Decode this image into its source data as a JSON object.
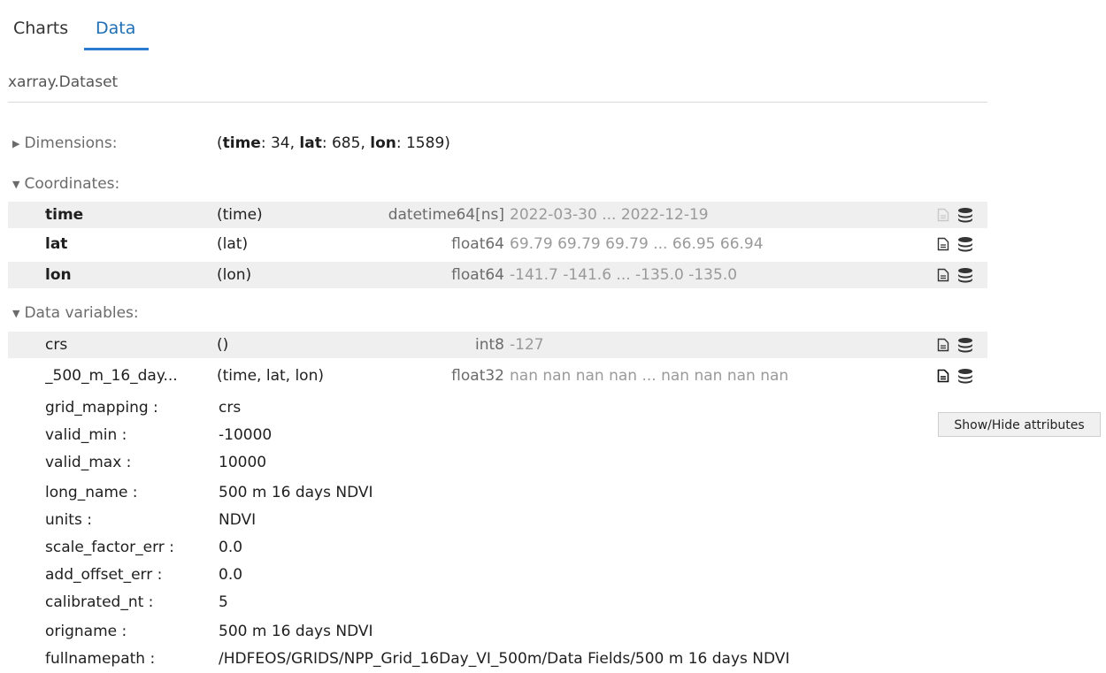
{
  "tabs": {
    "charts": "Charts",
    "data": "Data"
  },
  "dataset_title": "xarray.Dataset",
  "sections": {
    "dimensions": "Dimensions:",
    "coordinates": "Coordinates:",
    "data_variables": "Data variables:"
  },
  "dims": {
    "open": "(",
    "time_key": "time",
    "time_val": ": 34, ",
    "lat_key": "lat",
    "lat_val": ": 685, ",
    "lon_key": "lon",
    "lon_val": ": 1589)"
  },
  "coordinates": [
    {
      "name": "time",
      "dims": "(time)",
      "dtype": "datetime64[ns]",
      "preview": "2022-03-30 ... 2022-12-19"
    },
    {
      "name": "lat",
      "dims": "(lat)",
      "dtype": "float64",
      "preview": "69.79 69.79 69.79 ... 66.95 66.94"
    },
    {
      "name": "lon",
      "dims": "(lon)",
      "dtype": "float64",
      "preview": "-141.7 -141.6 ... -135.0 -135.0"
    }
  ],
  "data_variables": [
    {
      "name": "crs",
      "dims": "()",
      "dtype": "int8",
      "preview": "-127"
    },
    {
      "name": "_500_m_16_day...",
      "dims": "(time, lat, lon)",
      "dtype": "float32",
      "preview": "nan nan nan nan ... nan nan nan nan"
    }
  ],
  "attributes": [
    {
      "key": "grid_mapping :",
      "value": "crs"
    },
    {
      "key": "valid_min :",
      "value": "-10000"
    },
    {
      "key": "valid_max :",
      "value": "10000"
    },
    {
      "key": "long_name :",
      "value": "500 m 16 days NDVI"
    },
    {
      "key": "units :",
      "value": "NDVI"
    },
    {
      "key": "scale_factor_err :",
      "value": "0.0"
    },
    {
      "key": "add_offset_err :",
      "value": "0.0"
    },
    {
      "key": "calibrated_nt :",
      "value": "5"
    },
    {
      "key": "origname :",
      "value": "500 m 16 days NDVI"
    },
    {
      "key": "fullnamepath :",
      "value": "/HDFEOS/GRIDS/NPP_Grid_16Day_VI_500m/Data Fields/500 m 16 days NDVI"
    }
  ],
  "tooltip": "Show/Hide attributes",
  "icons": {
    "attrs": "file-text-icon",
    "data": "database-icon"
  },
  "colors": {
    "accent": "#2b7bd0",
    "shade": "#efefef"
  }
}
